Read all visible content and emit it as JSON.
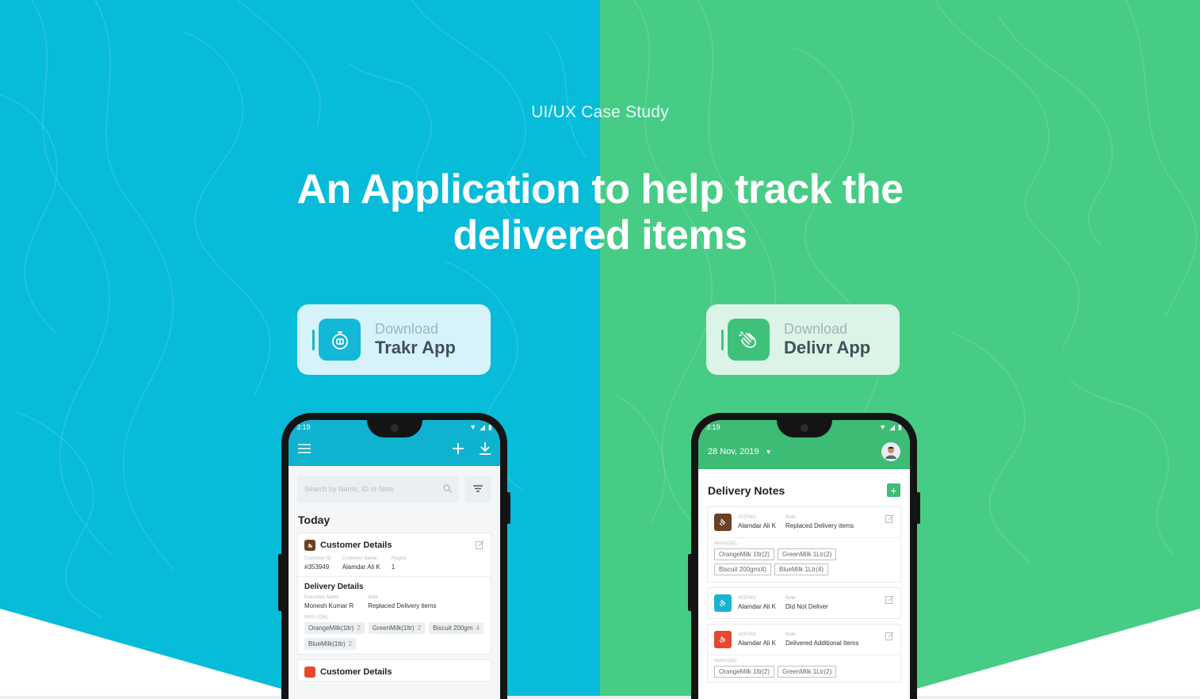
{
  "hero": {
    "eyebrow": "UI/UX Case Study",
    "headline_line1": "An Application to help track the",
    "headline_line2": "delivered items"
  },
  "colors": {
    "left_bg": "#06bcd9",
    "right_bg": "#47cc85"
  },
  "downloads": [
    {
      "sub": "Download",
      "title": "Trakr App",
      "icon": "stopwatch-icon"
    },
    {
      "sub": "Download",
      "title": "Delivr App",
      "icon": "hand-wave-icon"
    }
  ],
  "trakr_phone": {
    "time": "3:19",
    "search_placeholder": "Search by Name, ID or Note",
    "section": "Today",
    "card": {
      "title": "Customer Details",
      "customer_id_label": "Customer ID",
      "customer_id": "#353949",
      "customer_name_label": "Customer Name",
      "customer_name": "Alamdar Ali K",
      "region_label": "Region",
      "region": "1",
      "delivery_title": "Delivery Details",
      "exec_label": "Executive Name",
      "exec": "Monesh Kumar R",
      "note_label": "Note",
      "note": "Replaced Delivery items",
      "items_label": "Items (Qty)",
      "items": [
        {
          "name": "OrangeMilk(1ltr)",
          "qty": "2"
        },
        {
          "name": "GreenMilk(1ltr)",
          "qty": "2"
        },
        {
          "name": "Biscuit 200gm",
          "qty": "4"
        },
        {
          "name": "BlueMilk(1ltr)",
          "qty": "2"
        }
      ]
    },
    "next_card_title": "Customer Details"
  },
  "delivr_phone": {
    "time": "3:19",
    "date": "28 Nov, 2019",
    "title": "Delivery Notes",
    "notes": [
      {
        "id": "#237401",
        "name": "Alamdar Ali K",
        "note_label": "Note",
        "note": "Replaced Delivery items",
        "items_label": "Items(Qty)",
        "items": [
          "OrangeMilk 1ltr(2)",
          "GreenMilk 1Ltr(2)",
          "Biscuit 200gm(4)",
          "BlueMilk 1Ltr(4)"
        ]
      },
      {
        "id": "#237401",
        "name": "Alamdar Ali K",
        "note_label": "Note",
        "note": "Did Not Deliver"
      },
      {
        "id": "#237401",
        "name": "Alamdar Ali K",
        "note_label": "Note",
        "note": "Delivered Additional Items",
        "items_label": "Items(Qty)",
        "items": [
          "OrangeMilk 1ltr(2)",
          "GreenMilk 1Ltr(2)"
        ]
      }
    ]
  }
}
